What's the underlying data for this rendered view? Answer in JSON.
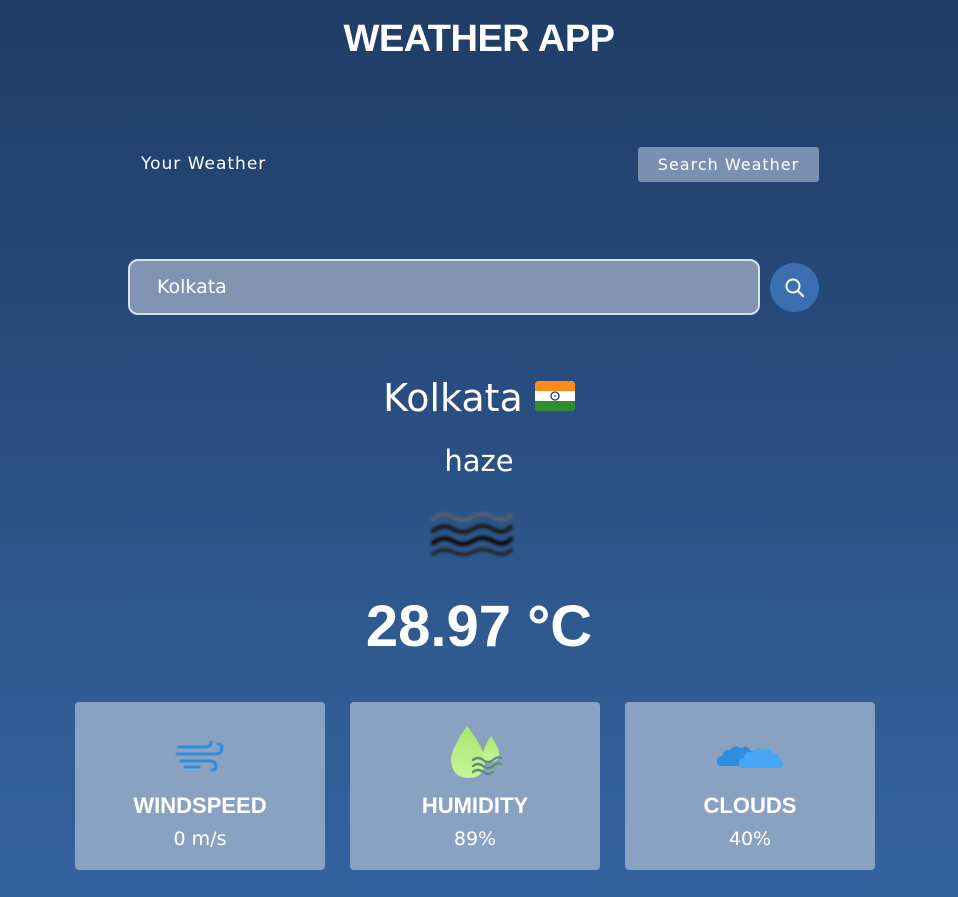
{
  "app": {
    "title": "WEATHER APP"
  },
  "tabs": [
    {
      "label": "Your Weather",
      "active": false
    },
    {
      "label": "Search Weather",
      "active": true
    }
  ],
  "search": {
    "value": "Kolkata",
    "button_icon": "search-icon"
  },
  "weather": {
    "city": "Kolkata",
    "country_flag": "flag-india-icon",
    "description": "haze",
    "icon": "haze-icon",
    "temperature": "28.97 °C"
  },
  "stats": [
    {
      "label": "WINDSPEED",
      "value": "0 m/s",
      "icon": "wind-icon"
    },
    {
      "label": "HUMIDITY",
      "value": "89%",
      "icon": "humidity-icon"
    },
    {
      "label": "CLOUDS",
      "value": "40%",
      "icon": "clouds-icon"
    }
  ],
  "colors": {
    "background_top": "#1f3d66",
    "background_bottom": "#3563a0",
    "card": "#8aa2c2",
    "search_button": "#3b6fb0",
    "active_tab": "#7a90b0"
  }
}
